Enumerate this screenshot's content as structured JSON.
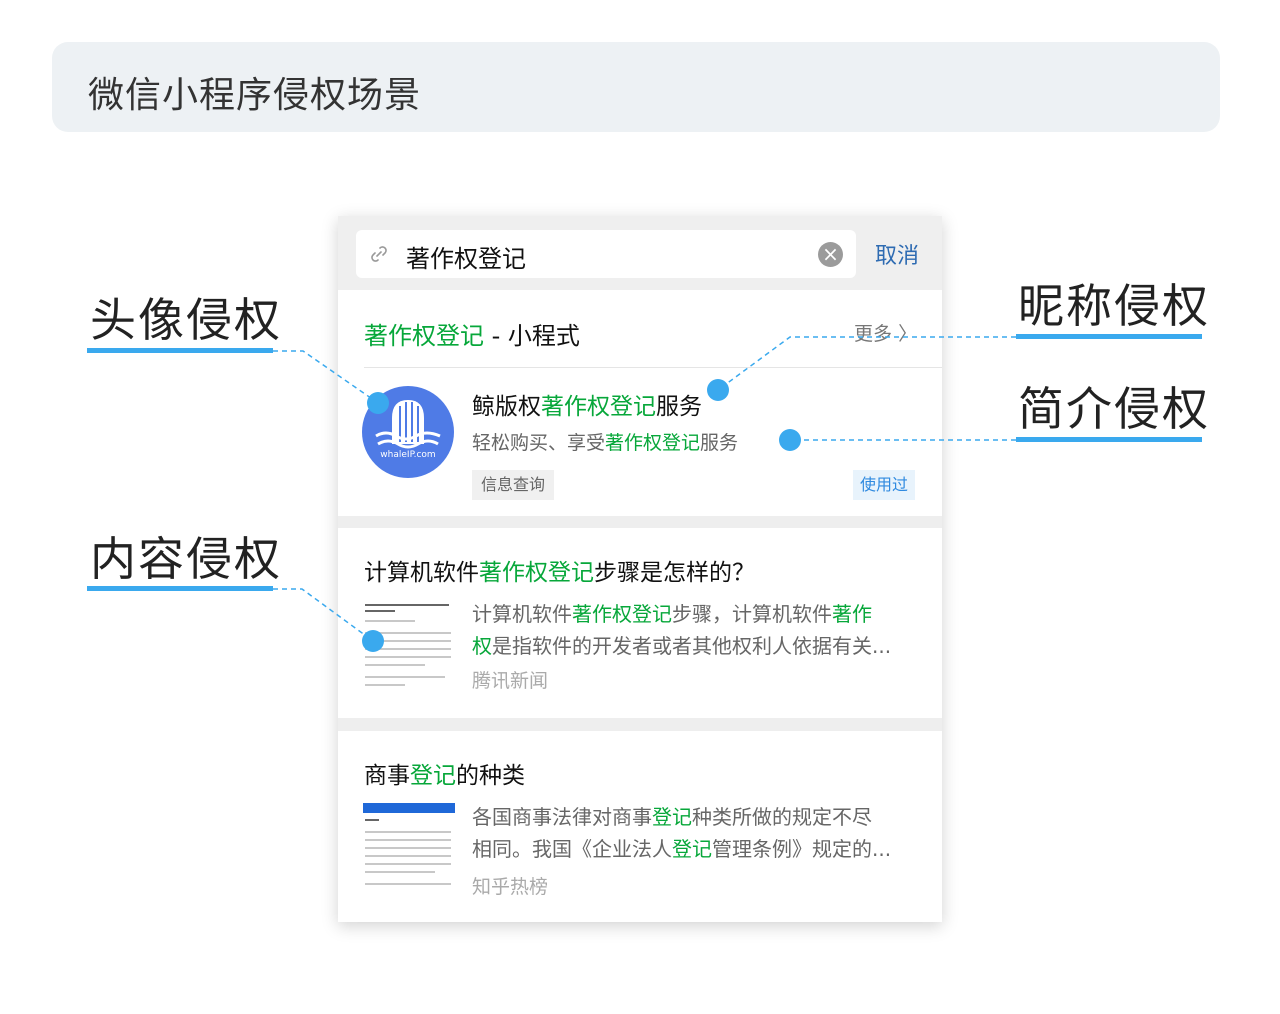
{
  "banner": {
    "title": "微信小程序侵权场景"
  },
  "annotations": {
    "avatar": "头像侵权",
    "nickname": "昵称侵权",
    "intro": "简介侵权",
    "content": "内容侵权"
  },
  "search": {
    "query": "著作权登记",
    "cancel_label": "取消",
    "clear_icon": "close-circle-icon",
    "link_icon": "link-icon"
  },
  "mini_program": {
    "header_highlight": "著作权登记",
    "header_suffix": " - 小程式",
    "more_label": "更多",
    "name_prefix": "鲸版权",
    "name_highlight": "著作权登记",
    "name_suffix": "服务",
    "desc_prefix": "轻松购买、享受",
    "desc_highlight": "著作权登记",
    "desc_suffix": "服务",
    "avatar_caption": "whaleIP.com",
    "tag_info": "信息查询",
    "tag_used": "使用过"
  },
  "articles": [
    {
      "title_prefix": "计算机软件",
      "title_highlight": "著作权登记",
      "title_suffix": "步骤是怎样的？",
      "body_line1_prefix": "计算机软件",
      "body_line1_highlight": "著作权登记",
      "body_line1_mid": "步骤，计算机软件",
      "body_line1_highlight2": "著作",
      "body_line2_highlight": "权",
      "body_line2_suffix": "是指软件的开发者或者其他权利人依据有关...",
      "source": "腾讯新闻"
    },
    {
      "title_prefix": "商事",
      "title_highlight": "登记",
      "title_suffix": "的种类",
      "body_line1_prefix": "各国商事法律对商事",
      "body_line1_highlight": "登记",
      "body_line1_suffix": "种类所做的规定不尽",
      "body_line2_prefix": "相同。我国《企业法人",
      "body_line2_highlight": "登记",
      "body_line2_suffix": "管理条例》规定的...",
      "source": "知乎热榜"
    }
  ],
  "colors": {
    "highlight": "#07a73a",
    "accent": "#3aa9ee",
    "link": "#2e6bb2",
    "avatar_bg": "#4f7be6"
  }
}
